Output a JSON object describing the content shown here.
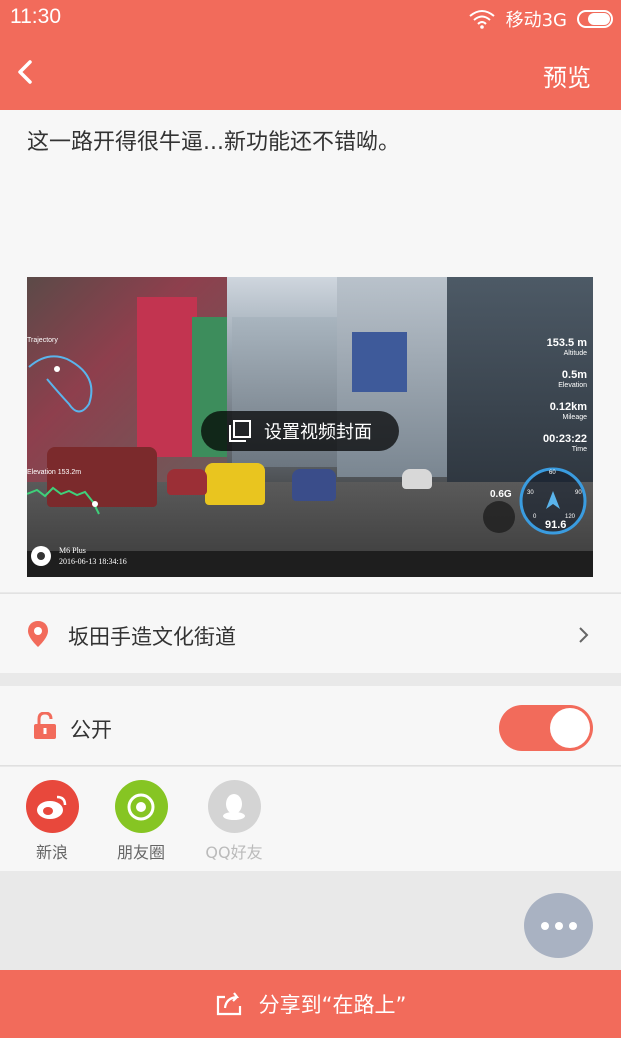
{
  "status_bar": {
    "time": "11:30",
    "carrier": "移动3G"
  },
  "app_bar": {
    "action": "预览"
  },
  "post": {
    "caption": "这一路开得很牛逼...新功能还不错呦。"
  },
  "video": {
    "cover_button": "设置视频封面",
    "trajectory_label": "Trajectory",
    "elevation_label": "Elevation  153.2m",
    "stats": [
      {
        "value": "153.5 m",
        "label": "Altitude"
      },
      {
        "value": "0.5m",
        "label": "Elevation"
      },
      {
        "value": "0.12km",
        "label": "Mileage"
      },
      {
        "value": "00:23:22",
        "label": "Time"
      }
    ],
    "gforce": "0.6G",
    "speed": "91.6",
    "gauge_ticks": [
      "60",
      "30",
      "90",
      "0",
      "120"
    ],
    "watermark_brand": "M6 Plus",
    "watermark_time": "2016-06-13  18:34:16"
  },
  "location": {
    "name": "坂田手造文化街道"
  },
  "privacy": {
    "label": "公开",
    "enabled": true
  },
  "share_targets": [
    {
      "label": "新浪",
      "color": "#e8483c",
      "icon": "weibo-icon"
    },
    {
      "label": "朋友圈",
      "color": "#86c523",
      "icon": "moments-icon"
    },
    {
      "label": "QQ好友",
      "color": "#d4d4d4",
      "icon": "qq-icon"
    }
  ],
  "bottom_button": {
    "label": "分享到“在路上”"
  },
  "colors": {
    "accent": "#f26b5b"
  }
}
